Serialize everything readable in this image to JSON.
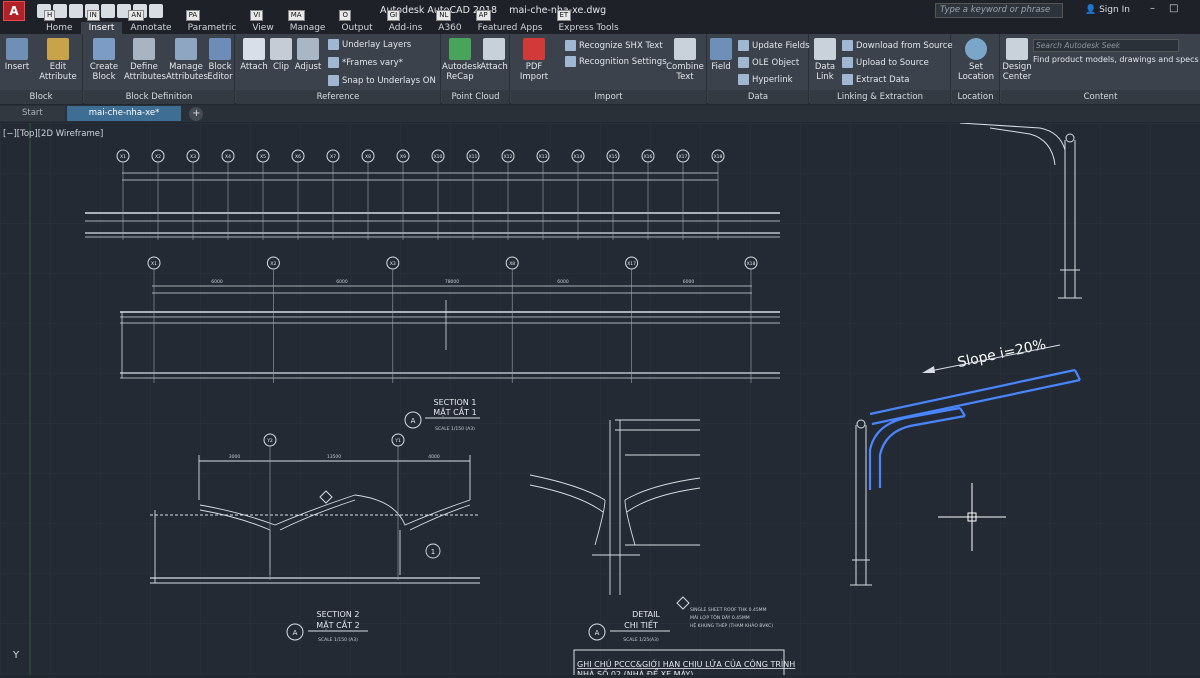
{
  "app": {
    "button_letter": "A",
    "title": "Autodesk AutoCAD 2018",
    "file": "mai-che-nha-xe.dwg"
  },
  "header": {
    "search_placeholder": "Type a keyword or phrase",
    "signin": "Sign In",
    "minimize": "–",
    "maximize": "□"
  },
  "tabs": [
    {
      "label": "Home",
      "key": "H"
    },
    {
      "label": "Insert",
      "key": "IN"
    },
    {
      "label": "Annotate",
      "key": "AN"
    },
    {
      "label": "Parametric",
      "key": "PA"
    },
    {
      "label": "View",
      "key": "VI"
    },
    {
      "label": "Manage",
      "key": "MA"
    },
    {
      "label": "Output",
      "key": "O"
    },
    {
      "label": "Add-ins",
      "key": "GI"
    },
    {
      "label": "A360",
      "key": "NL"
    },
    {
      "label": "Featured Apps",
      "key": "AP"
    },
    {
      "label": "Express Tools",
      "key": "ET"
    }
  ],
  "ribbon": {
    "block": {
      "title": "Block",
      "insert": "Insert",
      "edit_attr": "Edit Attribute"
    },
    "block_def": {
      "title": "Block Definition",
      "create": "Create Block",
      "define": "Define Attributes",
      "manage": "Manage Attributes",
      "editor": "Block Editor"
    },
    "reference": {
      "title": "Reference",
      "attach": "Attach",
      "clip": "Clip",
      "adjust": "Adjust",
      "underlay": "Underlay Layers",
      "frames": "*Frames vary*",
      "snap": "Snap to Underlays ON"
    },
    "pointcloud": {
      "title": "Point Cloud",
      "recap": "Autodesk ReCap",
      "attach": "Attach"
    },
    "import": {
      "title": "Import",
      "pdf": "PDF Import",
      "shx": "Recognize SHX Text",
      "recog": "Recognition Settings",
      "combine": "Combine Text"
    },
    "data": {
      "title": "Data",
      "field": "Field",
      "update": "Update Fields",
      "ole": "OLE Object",
      "hyperlink": "Hyperlink"
    },
    "linking": {
      "title": "Linking & Extraction",
      "datalink": "Data Link",
      "download": "Download from Source",
      "upload": "Upload to Source",
      "extract": "Extract  Data"
    },
    "location": {
      "title": "Location",
      "set": "Set Location"
    },
    "content": {
      "title": "Content",
      "design": "Design Center",
      "seek_placeholder": "Search Autodesk Seek",
      "seek_text": "Find product models, drawings and specs"
    }
  },
  "doc_tabs": {
    "start": "Start",
    "active": "mai-che-nha-xe*"
  },
  "viewport_label": "[−][Top][2D Wireframe]",
  "drawing": {
    "grid1": [
      "X1",
      "X2",
      "X3",
      "X4",
      "X5",
      "X6",
      "X7",
      "X8",
      "X9",
      "X10",
      "X11",
      "X12",
      "X13",
      "X14",
      "X15",
      "X16",
      "X17",
      "X18"
    ],
    "grid2": [
      "X1",
      "X2",
      "X3",
      "X8",
      "X17",
      "X18"
    ],
    "grid3": [
      "Y2",
      "Y1"
    ],
    "dim2": [
      "6000",
      "6000",
      "78000",
      "6000",
      "6000"
    ],
    "dim3": [
      "3000",
      "13500",
      "4000"
    ],
    "section1_en": "SECTION 1",
    "section1_vi": "MẶT CẮT 1",
    "scale1": "SCALE 1/150 (A3)",
    "section2_en": "SECTION 2",
    "section2_vi": "MẶT CẮT 2",
    "scale2": "SCALE 1/150 (A3)",
    "detail_en": "DETAIL",
    "detail_vi": "CHI TIẾT",
    "scale3": "SCALE 1/25(A3)",
    "slope_label": "Slope i=20%",
    "note_title": "GHI CHÚ PCCC&GIỚI HẠN CHỊU LỬA CỦA CÔNG TRÌNH",
    "note_sub": "NHÀ SỐ 02 (NHÀ ĐỂ XE MÁY)",
    "label_a": "A",
    "label_one": "1",
    "annotations": [
      "SINGLE SHEET ROOF THK 0.45MM",
      "MÁI LỢP TÔN DÀY 0.45MM",
      "HỆ KHUNG THÉP (THAM KHẢO BVKC)"
    ],
    "ucs_y": "Y"
  }
}
